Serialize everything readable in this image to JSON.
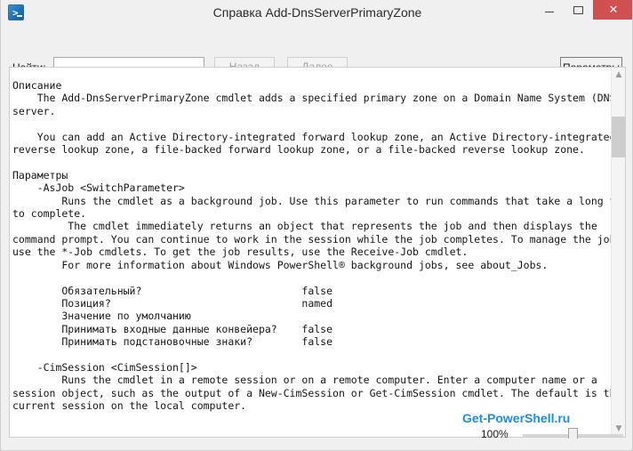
{
  "window": {
    "title": "Справка Add-DnsServerPrimaryZone",
    "app_icon": "powershell-icon",
    "controls": {
      "minimize": "–",
      "maximize": "□",
      "close": "✕"
    }
  },
  "toolbar": {
    "find_label": "Найти:",
    "find_value": "",
    "find_placeholder": "",
    "back_label": "Назад",
    "next_label": "Далее",
    "options_label": "Параметры"
  },
  "content": {
    "sections": [
      {
        "heading": "Описание",
        "body": "    The Add-DnsServerPrimaryZone cmdlet adds a specified primary zone on a Domain Name System (DNS)\nserver.\n\n    You can add an Active Directory-integrated forward lookup zone, an Active Directory-integrated\nreverse lookup zone, a file-backed forward lookup zone, or a file-backed reverse lookup zone.\n"
      },
      {
        "heading": "Параметры",
        "body": ""
      }
    ],
    "parameters": [
      {
        "name": "-AsJob",
        "type": "<SwitchParameter>",
        "description": "        Runs the cmdlet as a background job. Use this parameter to run commands that take a long time\nto complete.\n         The cmdlet immediately returns an object that represents the job and then displays the\ncommand prompt. You can continue to work in the session while the job completes. To manage the job,\nuse the *-Job cmdlets. To get the job results, use the Receive-Job cmdlet.\n        For more information about Windows PowerShell® background jobs, see about_Jobs.\n",
        "attributes": [
          {
            "label": "Обязательный?",
            "value": "false"
          },
          {
            "label": "Позиция?",
            "value": "named"
          },
          {
            "label": "Значение по умолчанию",
            "value": ""
          },
          {
            "label": "Принимать входные данные конвейера?",
            "value": "false"
          },
          {
            "label": "Принимать подстановочные знаки?",
            "value": "false"
          }
        ]
      },
      {
        "name": "-CimSession",
        "type": "<CimSession[]>",
        "description": "        Runs the cmdlet in a remote session or on a remote computer. Enter a computer name or a\nsession object, such as the output of a New-CimSession or Get-CimSession cmdlet. The default is the\ncurrent session on the local computer.",
        "attributes": []
      }
    ],
    "full_text": "Описание\n    The Add-DnsServerPrimaryZone cmdlet adds a specified primary zone on a Domain Name System (DNS)\nserver.\n\n    You can add an Active Directory-integrated forward lookup zone, an Active Directory-integrated\nreverse lookup zone, a file-backed forward lookup zone, or a file-backed reverse lookup zone.\n\nПараметры\n    -AsJob <SwitchParameter>\n        Runs the cmdlet as a background job. Use this parameter to run commands that take a long time\nto complete.\n         The cmdlet immediately returns an object that represents the job and then displays the\ncommand prompt. You can continue to work in the session while the job completes. To manage the job,\nuse the *-Job cmdlets. To get the job results, use the Receive-Job cmdlet.\n        For more information about Windows PowerShell® background jobs, see about_Jobs.\n\n        Обязательный?                          false\n        Позиция?                               named\n        Значение по умолчанию\n        Принимать входные данные конвейера?    false\n        Принимать подстановочные знаки?        false\n\n    -CimSession <CimSession[]>\n        Runs the cmdlet in a remote session or on a remote computer. Enter a computer name or a\nsession object, such as the output of a New-CimSession or Get-CimSession cmdlet. The default is the\ncurrent session on the local computer."
  },
  "scrollbar": {
    "up_arrow": "▲",
    "down_arrow": "▼",
    "thumb_top_pct": 10,
    "thumb_height_pct": 12
  },
  "watermark": {
    "text": "Get-PowerShell.ru"
  },
  "zoom": {
    "percent_label": "100%",
    "value": 100
  },
  "colors": {
    "accent_blue": "#1a8fe3",
    "close_red": "#d05050",
    "chrome": "#f0f0f0",
    "text": "#161616",
    "disabled_text": "#a0a0a0"
  }
}
